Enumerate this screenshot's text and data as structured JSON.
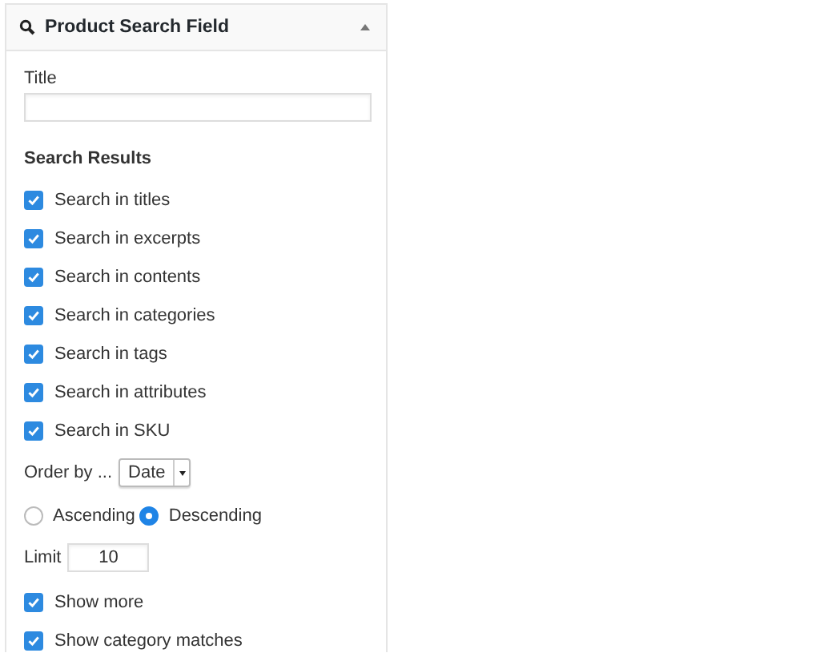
{
  "widget": {
    "title": "Product Search Field",
    "expanded": true
  },
  "title_field": {
    "label": "Title"
  },
  "section_title": "Search Results",
  "options": [
    {
      "label": "Search in titles",
      "checked": true
    },
    {
      "label": "Search in excerpts",
      "checked": true
    },
    {
      "label": "Search in contents",
      "checked": true
    },
    {
      "label": "Search in categories",
      "checked": true
    },
    {
      "label": "Search in tags",
      "checked": true
    },
    {
      "label": "Search in attributes",
      "checked": true
    },
    {
      "label": "Search in SKU",
      "checked": true
    }
  ],
  "order_by": {
    "label": "Order by ...",
    "value": "Date"
  },
  "order": [
    {
      "label": "Ascending",
      "selected": false
    },
    {
      "label": "Descending",
      "selected": true
    }
  ],
  "limit": {
    "label": "Limit",
    "value": "10"
  },
  "extras": [
    {
      "label": "Show more",
      "checked": true
    },
    {
      "label": "Show category matches",
      "checked": true
    }
  ]
}
